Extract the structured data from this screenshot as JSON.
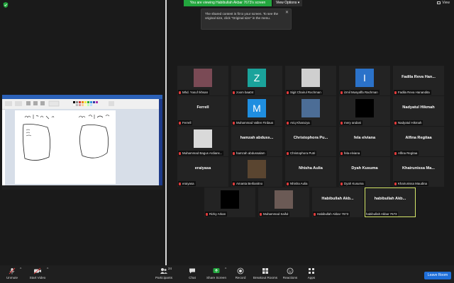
{
  "top": {
    "banner": "You are viewing Habibullah Akbar 7673's screen",
    "view_options": "View Options",
    "view": "View"
  },
  "tooltip": {
    "text": "The shared content is fit to your screen. To see the original size, click \"Original size\" in the menu.",
    "close": "✕"
  },
  "tiles": [
    {
      "label": "Mhd. Yusuf Ikhsan",
      "kind": "img",
      "color": "#7a4a55"
    },
    {
      "label": "zoom baa04",
      "kind": "letter",
      "letter": "Z",
      "color": "#1aa39b"
    },
    {
      "label": "Sigit Chairul Rochman",
      "kind": "img",
      "color": "#cfcfcf"
    },
    {
      "label": "izmil Musyaffa Rachman",
      "kind": "letter",
      "letter": "I",
      "color": "#2b72c9"
    },
    {
      "label": "Fadila Reva Hanandita",
      "kind": "name",
      "big": "Fadila Reva Han..."
    },
    {
      "label": "Ferrell",
      "kind": "name",
      "big": "Ferrell"
    },
    {
      "label": "Muhammad Vallen Firdaus",
      "kind": "letter",
      "letter": "M",
      "color": "#1f8ee0"
    },
    {
      "label": "Ariq Kharazya",
      "kind": "img",
      "color": "#4c6d96"
    },
    {
      "label": "mery andani",
      "kind": "img",
      "color": "#000000"
    },
    {
      "label": "Nadyatul Hikmah",
      "kind": "name",
      "big": "Nadyatul Hikmah"
    },
    {
      "label": "Muhammad Bagus Ardians...",
      "kind": "img",
      "color": "#d9d9d9"
    },
    {
      "label": "hamzah abdussalam",
      "kind": "name",
      "big": "hamzah abduss..."
    },
    {
      "label": "Christophora Putri",
      "kind": "name",
      "big": "Christophora Pu..."
    },
    {
      "label": "fela elviana",
      "kind": "name",
      "big": "fela elviana"
    },
    {
      "label": "Alfina Regitaa",
      "kind": "name",
      "big": "Alfina Regitaa"
    },
    {
      "label": "eraiyasa",
      "kind": "name",
      "big": "eraiyasa"
    },
    {
      "label": "Amanta Berlianitno",
      "kind": "img",
      "color": "#5a4530"
    },
    {
      "label": "Nhisha Aulia",
      "kind": "name",
      "big": "Nhisha Aulia"
    },
    {
      "label": "Dyah Kusuma",
      "kind": "name",
      "big": "Dyah Kusuma"
    },
    {
      "label": "Khairunissa Maudina",
      "kind": "name",
      "big": "Khairunissa Ma..."
    },
    {
      "label": "Rizky Arkan",
      "kind": "img",
      "color": "#000000"
    },
    {
      "label": "Muhammad Saiful",
      "kind": "img",
      "color": "#6b5a55"
    },
    {
      "label": "Habibullah Akbar 7673",
      "kind": "name",
      "big": "Habibullah Akb..."
    },
    {
      "label": "habibullah Akbar 7673",
      "kind": "name",
      "big": "habibullah Akb...",
      "active": true
    }
  ],
  "toolbar": {
    "unmute": "Unmute",
    "start_video": "Start Video",
    "participants": "Participants",
    "participants_count": "24",
    "chat": "Chat",
    "share_screen": "Share Screen",
    "record": "Record",
    "breakout": "Breakout Rooms",
    "reactions": "Reactions",
    "apps": "Apps",
    "leave": "Leave Room"
  },
  "colors": {
    "accent": "#23a63e",
    "leave": "#1f6fd9",
    "active_border": "#d6e86a",
    "muted": "#e03b3b"
  }
}
